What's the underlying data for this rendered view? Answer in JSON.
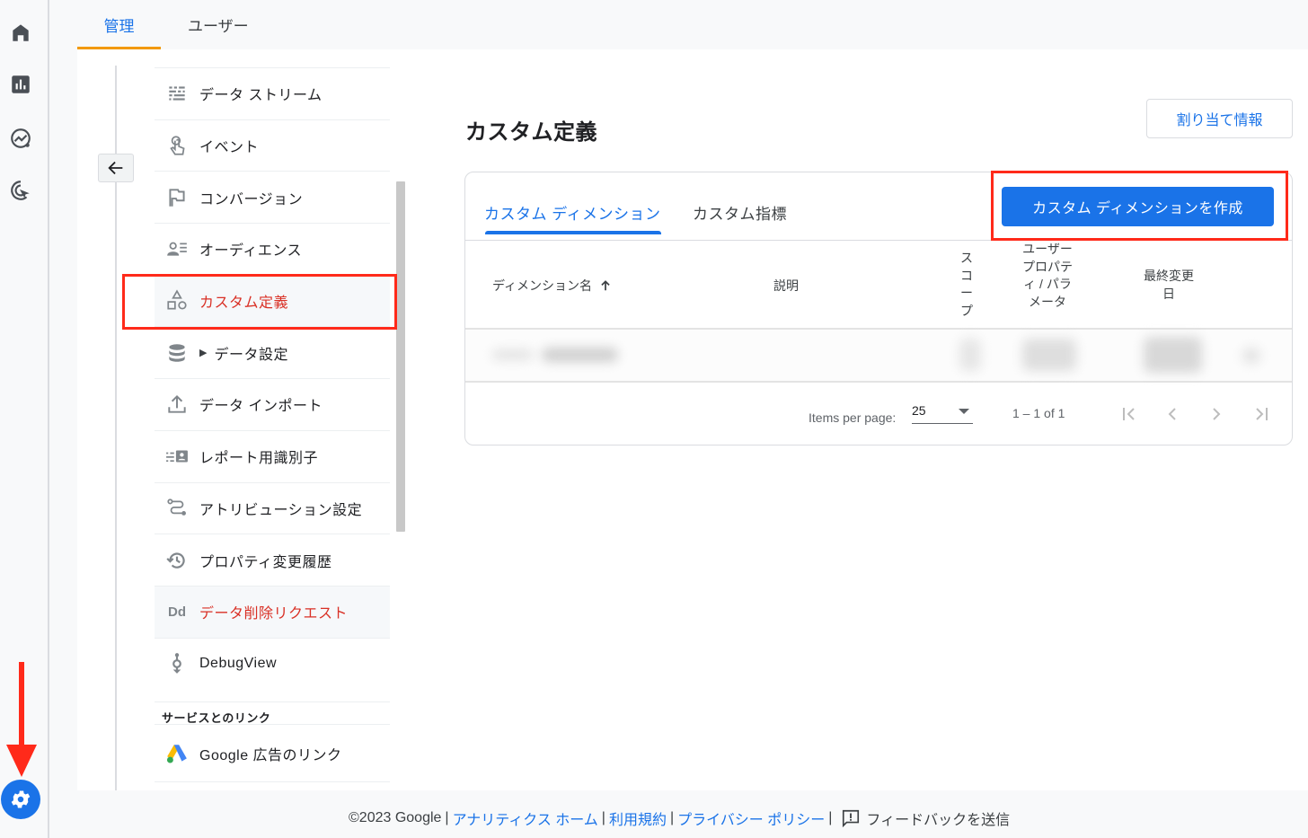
{
  "rail": {
    "items": [
      {
        "icon": "home-icon",
        "label": "Home"
      },
      {
        "icon": "reports-icon",
        "label": "Reports"
      },
      {
        "icon": "explore-icon",
        "label": "Explore"
      },
      {
        "icon": "advertising-icon",
        "label": "Advertising"
      }
    ],
    "settings_icon": "gear-icon"
  },
  "top_tabs": [
    {
      "label": "管理",
      "active": true
    },
    {
      "label": "ユーザー",
      "active": false
    }
  ],
  "nav": {
    "items": [
      {
        "label": "データ ストリーム",
        "icon": "data-streams-icon"
      },
      {
        "label": "イベント",
        "icon": "touch-icon"
      },
      {
        "label": "コンバージョン",
        "icon": "flag-icon"
      },
      {
        "label": "オーディエンス",
        "icon": "audience-icon"
      },
      {
        "label": "カスタム定義",
        "icon": "shapes-icon",
        "active": true
      },
      {
        "label": "データ設定",
        "icon": "database-icon",
        "expandable": true
      },
      {
        "label": "データ インポート",
        "icon": "upload-icon"
      },
      {
        "label": "レポート用識別子",
        "icon": "identity-icon"
      },
      {
        "label": "アトリビューション設定",
        "icon": "attribution-icon"
      },
      {
        "label": "プロパティ変更履歴",
        "icon": "history-icon"
      },
      {
        "label": "データ削除リクエスト",
        "icon": "dd-icon",
        "icon_text": "Dd",
        "danger": true
      },
      {
        "label": "DebugView",
        "icon": "debug-icon"
      }
    ],
    "section_heading": "サービスとのリンク",
    "link_items": [
      {
        "label": "Google 広告のリンク",
        "icon": "google-ads-icon"
      }
    ]
  },
  "main": {
    "title": "カスタム定義",
    "assign_button": "割り当て情報",
    "tabs": [
      {
        "label": "カスタム ディメンション",
        "active": true
      },
      {
        "label": "カスタム指標",
        "active": false
      }
    ],
    "create_button": "カスタム ディメンションを作成",
    "table": {
      "columns": [
        {
          "label": "ディメンション名",
          "sorted": "ascending"
        },
        {
          "label": "説明"
        },
        {
          "label": "スコープ"
        },
        {
          "label": "ユーザー プロパティ / パラメータ"
        },
        {
          "label": "最終変更日"
        }
      ],
      "rows": [
        {
          "blurred": true
        }
      ]
    },
    "pager": {
      "items_per_page_label": "Items per page:",
      "items_per_page": "25",
      "range": "1 – 1 of 1"
    }
  },
  "footer": {
    "copyright": "©2023 Google",
    "links": [
      "アナリティクス ホーム",
      "利用規約",
      "プライバシー ポリシー"
    ],
    "feedback": "フィードバックを送信"
  },
  "colors": {
    "accent": "#1a73e8",
    "active_tab_underline": "#f29900",
    "highlight": "#d93025",
    "annotation": "#ff2a1a"
  }
}
